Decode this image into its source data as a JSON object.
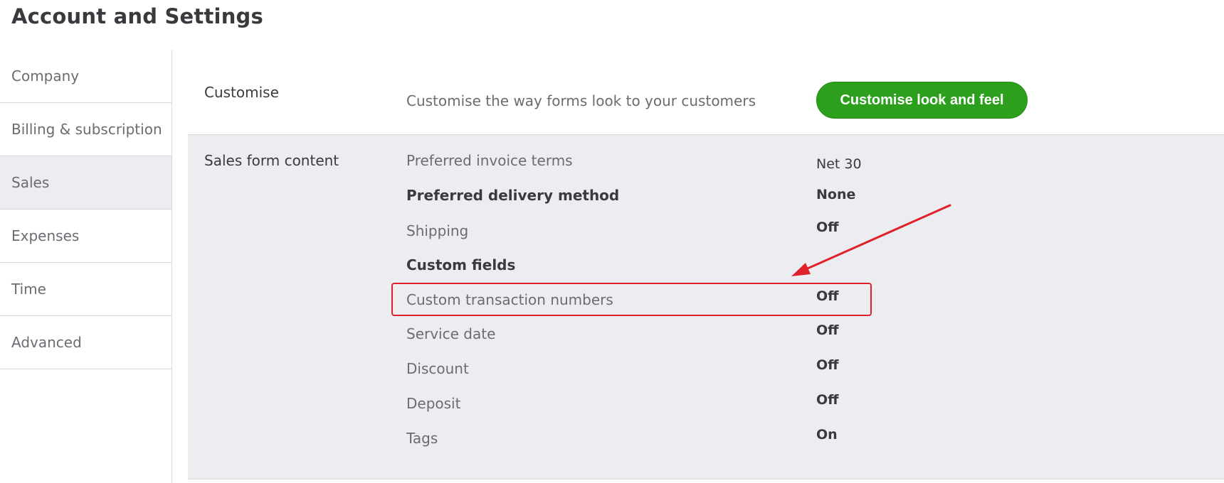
{
  "page": {
    "title": "Account and Settings"
  },
  "sidebar": {
    "items": [
      {
        "label": "Company"
      },
      {
        "label": "Billing & subscription"
      },
      {
        "label": "Sales"
      },
      {
        "label": "Expenses"
      },
      {
        "label": "Time"
      },
      {
        "label": "Advanced"
      }
    ],
    "active": "Sales"
  },
  "customise": {
    "label": "Customise",
    "description": "Customise the way forms look to your customers",
    "button_label": "Customise look and feel"
  },
  "sales_form_content": {
    "label": "Sales form content",
    "rows": [
      {
        "label": "Preferred invoice terms",
        "value": "Net 30"
      },
      {
        "label": "Preferred delivery method",
        "value": "None"
      },
      {
        "label": "Shipping",
        "value": "Off"
      },
      {
        "label": "Custom fields",
        "value": ""
      },
      {
        "label": "Custom transaction numbers",
        "value": "Off"
      },
      {
        "label": "Service date",
        "value": "Off"
      },
      {
        "label": "Discount",
        "value": "Off"
      },
      {
        "label": "Deposit",
        "value": "Off"
      },
      {
        "label": "Tags",
        "value": "On"
      }
    ]
  },
  "colors": {
    "accent_green": "#2ca01c",
    "annotation_red": "#e0202a",
    "section_bg": "#ebedf0"
  }
}
